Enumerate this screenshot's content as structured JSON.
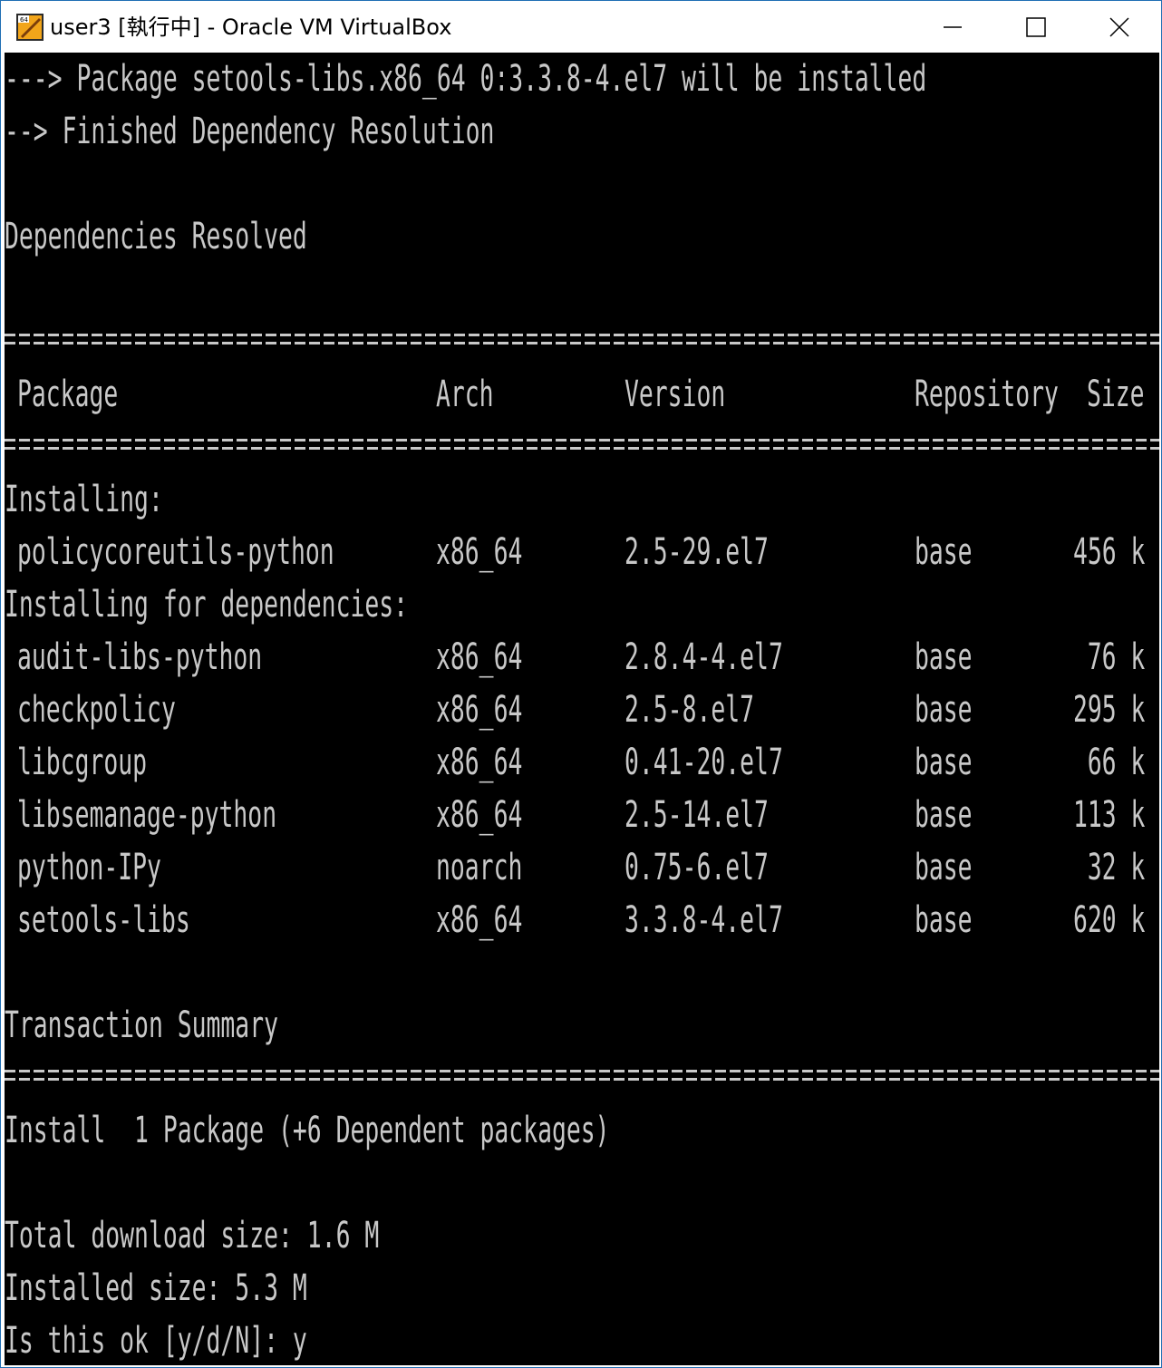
{
  "window": {
    "title": "user3 [執行中] - Oracle VM VirtualBox",
    "icon": "virtualbox-icon",
    "controls": {
      "minimize": "minimize-icon",
      "maximize": "maximize-icon",
      "close": "close-icon"
    }
  },
  "terminal": {
    "top_lines": [
      "---> Package setools-libs.x86_64 0:3.3.8-4.el7 will be installed",
      "--> Finished Dependency Resolution",
      "Dependencies Resolved"
    ],
    "table": {
      "headers": {
        "package": "Package",
        "arch": "Arch",
        "version": "Version",
        "repository": "Repository",
        "size": "Size"
      },
      "installing_label": "Installing:",
      "installing": [
        {
          "package": "policycoreutils-python",
          "arch": "x86_64",
          "version": "2.5-29.el7",
          "repository": "base",
          "size": "456 k"
        }
      ],
      "dependencies_label": "Installing for dependencies:",
      "dependencies": [
        {
          "package": "audit-libs-python",
          "arch": "x86_64",
          "version": "2.8.4-4.el7",
          "repository": "base",
          "size": "76 k"
        },
        {
          "package": "checkpolicy",
          "arch": "x86_64",
          "version": "2.5-8.el7",
          "repository": "base",
          "size": "295 k"
        },
        {
          "package": "libcgroup",
          "arch": "x86_64",
          "version": "0.41-20.el7",
          "repository": "base",
          "size": "66 k"
        },
        {
          "package": "libsemanage-python",
          "arch": "x86_64",
          "version": "2.5-14.el7",
          "repository": "base",
          "size": "113 k"
        },
        {
          "package": "python-IPy",
          "arch": "noarch",
          "version": "0.75-6.el7",
          "repository": "base",
          "size": "32 k"
        },
        {
          "package": "setools-libs",
          "arch": "x86_64",
          "version": "3.3.8-4.el7",
          "repository": "base",
          "size": "620 k"
        }
      ]
    },
    "summary_title": "Transaction Summary",
    "install_line": "Install  1 Package (+6 Dependent packages)",
    "download_size": "Total download size: 1.6 M",
    "installed_size": "Installed size: 5.3 M",
    "prompt": "Is this ok [y/d/N]: y"
  }
}
